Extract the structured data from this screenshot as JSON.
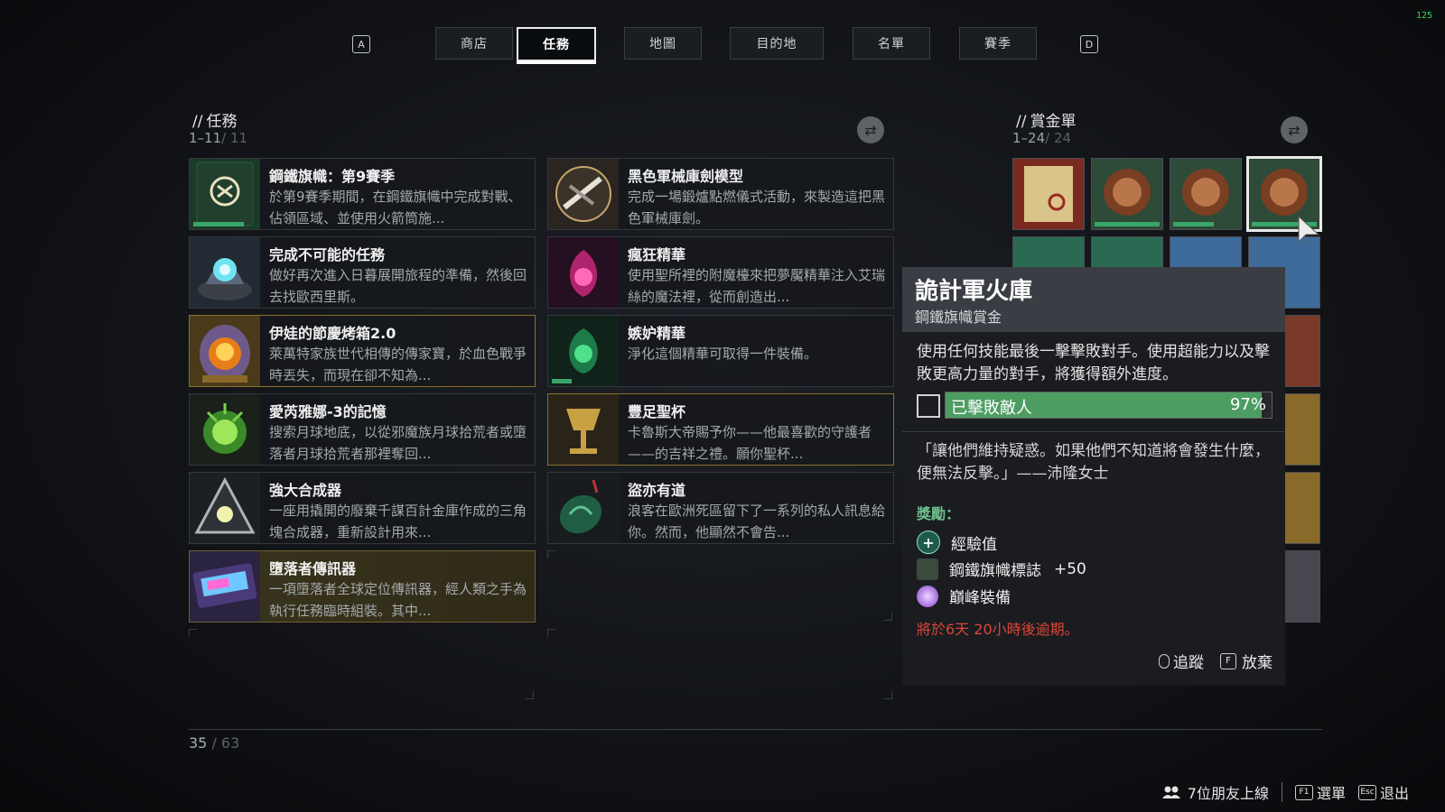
{
  "fps": "125",
  "nav": {
    "left_key": "A",
    "right_key": "D",
    "tabs": [
      {
        "label": "商店",
        "active": false
      },
      {
        "label": "任務",
        "active": true
      },
      {
        "label": "地圖",
        "active": false
      },
      {
        "label": "目的地",
        "active": false
      },
      {
        "label": "名單",
        "active": false
      },
      {
        "label": "賽季",
        "active": false
      }
    ]
  },
  "quests": {
    "title": "任務",
    "range": "1–11",
    "total": "/ 11",
    "items": [
      {
        "name": "鋼鐵旗幟：第9賽季",
        "desc": "於第9賽季期間，在鋼鐵旗幟中完成對戰、佔領區域、並使用火箭筒施...",
        "icon": "iron-banner-book-icon",
        "progress": 0.8
      },
      {
        "name": "黑色軍械庫劍模型",
        "desc": "完成一場鍛爐點燃儀式活動，來製造這把黑色軍械庫劍。",
        "icon": "black-armory-sword-icon",
        "progress": null
      },
      {
        "name": "完成不可能的任務",
        "desc": "做好再次進入日暮展開旅程的準備，然後回去找歐西里斯。",
        "icon": "ghost-device-icon",
        "progress": null
      },
      {
        "name": "瘋狂精華",
        "desc": "使用聖所裡的附魔檯來把夢魘精華注入艾瑞絲的魔法裡，從而創造出...",
        "icon": "madness-essence-icon",
        "progress": null
      },
      {
        "name": "伊娃的節慶烤箱2.0",
        "desc": "萊萬特家族世代相傳的傳家寶，於血色戰爭時丟失，而現在卻不知為...",
        "icon": "holiday-oven-icon",
        "progress": null
      },
      {
        "name": "嫉妒精華",
        "desc": "淨化這個精華可取得一件裝備。",
        "icon": "envy-essence-icon",
        "progress": 0.3
      },
      {
        "name": "愛芮雅娜-3的記憶",
        "desc": "搜索月球地底，以從邪魔族月球拾荒者或墮落者月球拾荒者那裡奪回...",
        "icon": "memory-orb-icon",
        "progress": null
      },
      {
        "name": "豐足聖杯",
        "desc": "卡魯斯大帝賜予你——他最喜歡的守護者——的吉祥之禮。願你聖杯...",
        "icon": "chalice-icon",
        "progress": null
      },
      {
        "name": "強大合成器",
        "desc": "一座用撬開的廢棄千謀百計金庫作成的三角塊合成器，重新設計用來...",
        "icon": "synthesizer-icon",
        "progress": null
      },
      {
        "name": "盜亦有道",
        "desc": "浪客在歐洲死區留下了一系列的私人訊息給你。然而，他顯然不會告...",
        "icon": "jade-pendant-icon",
        "progress": null
      },
      {
        "name": "墮落者傳訊器",
        "desc": "一項墮落者全球定位傳訊器，經人類之手為執行任務臨時組裝。其中...",
        "icon": "fallen-transmitter-icon",
        "progress": null
      }
    ]
  },
  "bounties": {
    "title": "賞金單",
    "range": "1–24",
    "total": "/ 24"
  },
  "tooltip": {
    "title": "詭計軍火庫",
    "subtitle": "鋼鐵旗幟賞金",
    "description": "使用任何技能最後一擊擊敗對手。使用超能力以及擊敗更高力量的對手，將獲得額外進度。",
    "objective": {
      "label": "已擊敗敵人",
      "percent_text": "97%",
      "progress": 0.97
    },
    "lore": "「讓他們維持疑惑。如果他們不知道將會發生什麼，便無法反擊。」——沛隆女士",
    "rewards_title": "獎勵：",
    "rewards": [
      {
        "label": "經驗值",
        "amount": "",
        "icon": "xp-plus-icon"
      },
      {
        "label": "鋼鐵旗幟標誌",
        "amount": "+50",
        "icon": "iron-banner-token-icon"
      },
      {
        "label": "巔峰裝備",
        "amount": "",
        "icon": "pinnacle-gear-icon"
      }
    ],
    "expiry": "將於6天 20小時後逾期。",
    "track_label": "追蹤",
    "abandon_key": "F",
    "abandon_label": "放棄"
  },
  "pagination": {
    "current": "35",
    "total": "/ 63"
  },
  "footer": {
    "friends": "7位朋友上線",
    "menu_key": "F1",
    "menu_label": "選單",
    "exit_key": "Esc",
    "exit_label": "退出"
  },
  "colors": {
    "progress_green": "#3aa56a",
    "expire_red": "#d9463a",
    "reward_green": "#6bbf8c"
  }
}
